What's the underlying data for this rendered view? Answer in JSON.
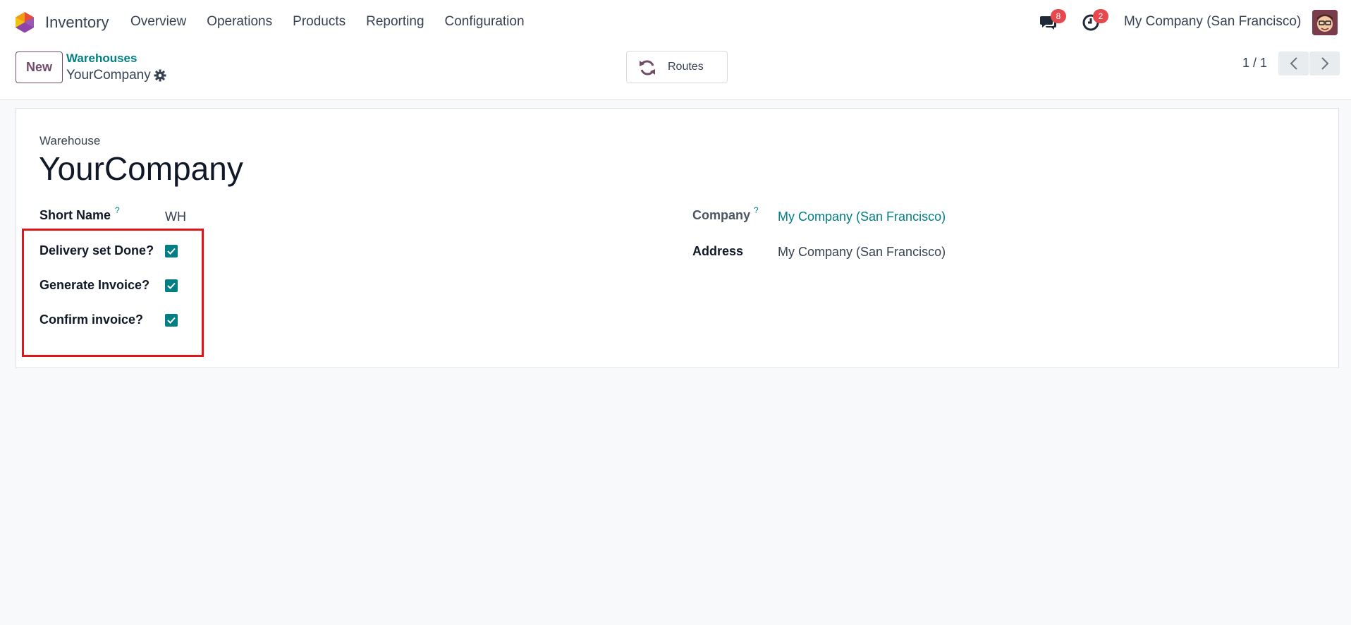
{
  "navbar": {
    "app_name": "Inventory",
    "menu": [
      "Overview",
      "Operations",
      "Products",
      "Reporting",
      "Configuration"
    ],
    "messages_badge": "8",
    "activities_badge": "2",
    "company": "My Company (San Francisco)"
  },
  "control_panel": {
    "new_label": "New",
    "breadcrumb_parent": "Warehouses",
    "breadcrumb_current": "YourCompany",
    "routes_label": "Routes",
    "pager": "1 / 1"
  },
  "form": {
    "header_label": "Warehouse",
    "name": "YourCompany",
    "short_name_label": "Short Name",
    "short_name_help": "?",
    "short_name_value": "WH",
    "company_label": "Company",
    "company_help": "?",
    "company_value": "My Company (San Francisco)",
    "address_label": "Address",
    "address_value": "My Company (San Francisco)",
    "checkboxes": [
      {
        "label": "Delivery set Done?",
        "checked": true
      },
      {
        "label": "Generate Invoice?",
        "checked": true
      },
      {
        "label": "Confirm invoice?",
        "checked": true
      }
    ]
  },
  "colors": {
    "accent": "#017e84",
    "brand": "#714b67",
    "badge": "#e5484d",
    "highlight": "#e0141b"
  },
  "icons": [
    "odoo-logo-icon",
    "chat-icon",
    "clock-icon",
    "gear-icon",
    "refresh-icon",
    "chevron-left-icon",
    "chevron-right-icon",
    "check-icon"
  ]
}
